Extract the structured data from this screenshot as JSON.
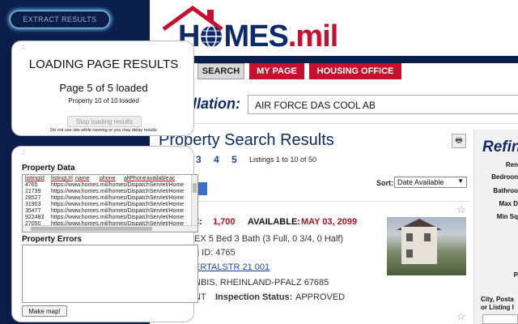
{
  "extension": {
    "extract_button": "EXTRACT RESULTS",
    "loading": {
      "drag": "::",
      "title": "LOADING PAGE RESULTS",
      "pages_loaded": "Page 5 of 5 loaded",
      "properties_loaded": "Property 10 of 10 loaded",
      "stop_button": "Stop loading results",
      "note": "Do not use site while running or you may delay results"
    },
    "data_card": {
      "drag": "::",
      "property_data_title": "Property Data",
      "columns": [
        "listingId",
        "listingUrl",
        "name",
        "phone",
        "altPhone",
        "available",
        "ac"
      ],
      "rows": [
        [
          "4765",
          "https://www.homes.mil/homes/DispatchServlet/Home"
        ],
        [
          "21739",
          "https://www.homes.mil/homes/DispatchServlet/Home"
        ],
        [
          "28527",
          "https://www.homes.mil/homes/DispatchServlet/Home"
        ],
        [
          "31903",
          "https://www.homes.mil/homes/DispatchServlet/Home"
        ],
        [
          "35477",
          "https://www.homes.mil/homes/DispatchServlet/Home"
        ],
        [
          "922483",
          "https://www.homes.mil/homes/DispatchServlet/Home"
        ],
        [
          "27050",
          "https://www.homes.mil/homes/DispatchServlet/Home"
        ]
      ],
      "property_errors_title": "Property Errors",
      "make_map_button": "Make map!"
    }
  },
  "site": {
    "logo_text_main": "H",
    "logo_text_rest": "MES",
    "logo_text_suffix": ".mil",
    "nav": {
      "search": "SEARCH",
      "my_page": "MY PAGE",
      "housing_office": "HOUSING OFFICE"
    },
    "installation_label": "allation:",
    "installation_value": "AIR FORCE DAS COOL AB",
    "results_title": "Property Search Results",
    "print_icon": "🖶",
    "pages": [
      "3",
      "4",
      "5"
    ],
    "listing_count": "Listings 1 to 10 of 50",
    "sort_label": "Sort:",
    "sort_value": "Date Available",
    "listing": {
      "price_label": "€:",
      "price": "1,700",
      "available_label": "AVAILABLE:",
      "available_date": "MAY 03, 2099",
      "beds_baths": "EX    5 Bed    3 Bath (3 Full, 0 3/4, 0 Half)",
      "listing_id": "g ID: 4765",
      "street": "ERTALSTR 21 001",
      "city": "NBIS, RHEINLAND-PFALZ 67685",
      "status_prefix": "NT",
      "status_label": "Inspection Status:",
      "status_value": "APPROVED"
    },
    "refine": {
      "title": "Refin",
      "labels": [
        "Ren",
        "Bedroon",
        "Bathroo",
        "Max D",
        "Min Sq",
        "P"
      ],
      "city_label": "City, Posta or Listing I"
    },
    "accent_red": "#c8102e",
    "accent_navy": "#0d2a6b"
  }
}
